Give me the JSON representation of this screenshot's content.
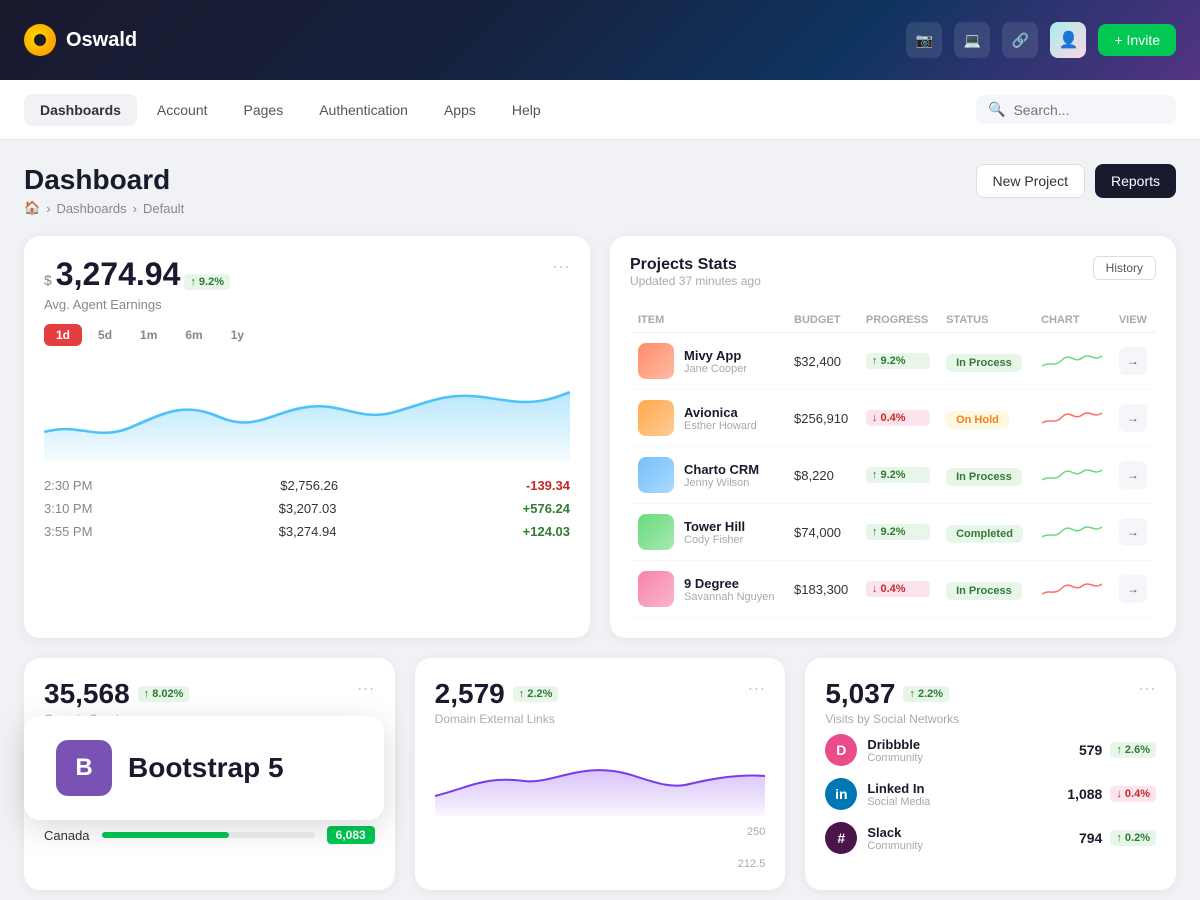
{
  "app": {
    "logo_text": "Oswald",
    "invite_label": "+ Invite"
  },
  "nav": {
    "items": [
      {
        "id": "dashboards",
        "label": "Dashboards",
        "active": true
      },
      {
        "id": "account",
        "label": "Account",
        "active": false
      },
      {
        "id": "pages",
        "label": "Pages",
        "active": false
      },
      {
        "id": "authentication",
        "label": "Authentication",
        "active": false
      },
      {
        "id": "apps",
        "label": "Apps",
        "active": false
      },
      {
        "id": "help",
        "label": "Help",
        "active": false
      }
    ],
    "search_placeholder": "Search..."
  },
  "page": {
    "title": "Dashboard",
    "breadcrumb": [
      "Dashboards",
      "Default"
    ],
    "new_project_label": "New Project",
    "reports_label": "Reports"
  },
  "earnings_card": {
    "currency": "$",
    "amount": "3,274.94",
    "badge": "↑ 9.2%",
    "label": "Avg. Agent Earnings",
    "time_filters": [
      "1d",
      "5d",
      "1m",
      "6m",
      "1y"
    ],
    "active_filter": "1d",
    "more": "···",
    "rows": [
      {
        "time": "2:30 PM",
        "value": "$2,756.26",
        "change": "-139.34",
        "positive": false
      },
      {
        "time": "3:10 PM",
        "value": "$3,207.03",
        "change": "+576.24",
        "positive": true
      },
      {
        "time": "3:55 PM",
        "value": "$3,274.94",
        "change": "+124.03",
        "positive": true
      }
    ]
  },
  "projects": {
    "title": "Projects Stats",
    "subtitle": "Updated 37 minutes ago",
    "history_label": "History",
    "columns": [
      "ITEM",
      "BUDGET",
      "PROGRESS",
      "STATUS",
      "CHART",
      "VIEW"
    ],
    "rows": [
      {
        "name": "Mivy App",
        "person": "Jane Cooper",
        "budget": "$32,400",
        "progress": "↑ 9.2%",
        "progress_positive": true,
        "status": "In Process",
        "status_type": "inprocess",
        "color": "#ff6b6b"
      },
      {
        "name": "Avionica",
        "person": "Esther Howard",
        "budget": "$256,910",
        "progress": "↓ 0.4%",
        "progress_positive": false,
        "status": "On Hold",
        "status_type": "onhold",
        "color": "#ffa94d"
      },
      {
        "name": "Charto CRM",
        "person": "Jenny Wilson",
        "budget": "$8,220",
        "progress": "↑ 9.2%",
        "progress_positive": true,
        "status": "In Process",
        "status_type": "inprocess",
        "color": "#74c0fc"
      },
      {
        "name": "Tower Hill",
        "person": "Cody Fisher",
        "budget": "$74,000",
        "progress": "↑ 9.2%",
        "progress_positive": true,
        "status": "Completed",
        "status_type": "completed",
        "color": "#69db7c"
      },
      {
        "name": "9 Degree",
        "person": "Savannah Nguyen",
        "budget": "$183,300",
        "progress": "↓ 0.4%",
        "progress_positive": false,
        "status": "In Process",
        "status_type": "inprocess",
        "color": "#f783ac"
      }
    ]
  },
  "organic_sessions": {
    "number": "35,568",
    "badge": "↑ 8.02%",
    "label": "Organic Sessions",
    "more": "···",
    "country_rows": [
      {
        "name": "Canada",
        "value": "6,083",
        "pct": 60
      }
    ]
  },
  "external_links": {
    "number": "2,579",
    "badge": "↑ 2.2%",
    "label": "Domain External Links",
    "more": "···"
  },
  "social_networks": {
    "number": "5,037",
    "badge": "↑ 2.2%",
    "label": "Visits by Social Networks",
    "more": "···",
    "items": [
      {
        "name": "Dribbble",
        "type": "Community",
        "count": "579",
        "badge": "↑ 2.6%",
        "positive": true,
        "icon": "D",
        "class": "dribbble"
      },
      {
        "name": "Linked In",
        "type": "Social Media",
        "count": "1,088",
        "badge": "↓ 0.4%",
        "positive": false,
        "icon": "in",
        "class": "linkedin"
      },
      {
        "name": "Slack",
        "type": "Community",
        "count": "794",
        "badge": "↑ 0.2%",
        "positive": true,
        "icon": "#",
        "class": "slack"
      }
    ]
  },
  "bootstrap_promo": {
    "icon_letter": "B",
    "text": "Bootstrap 5"
  }
}
